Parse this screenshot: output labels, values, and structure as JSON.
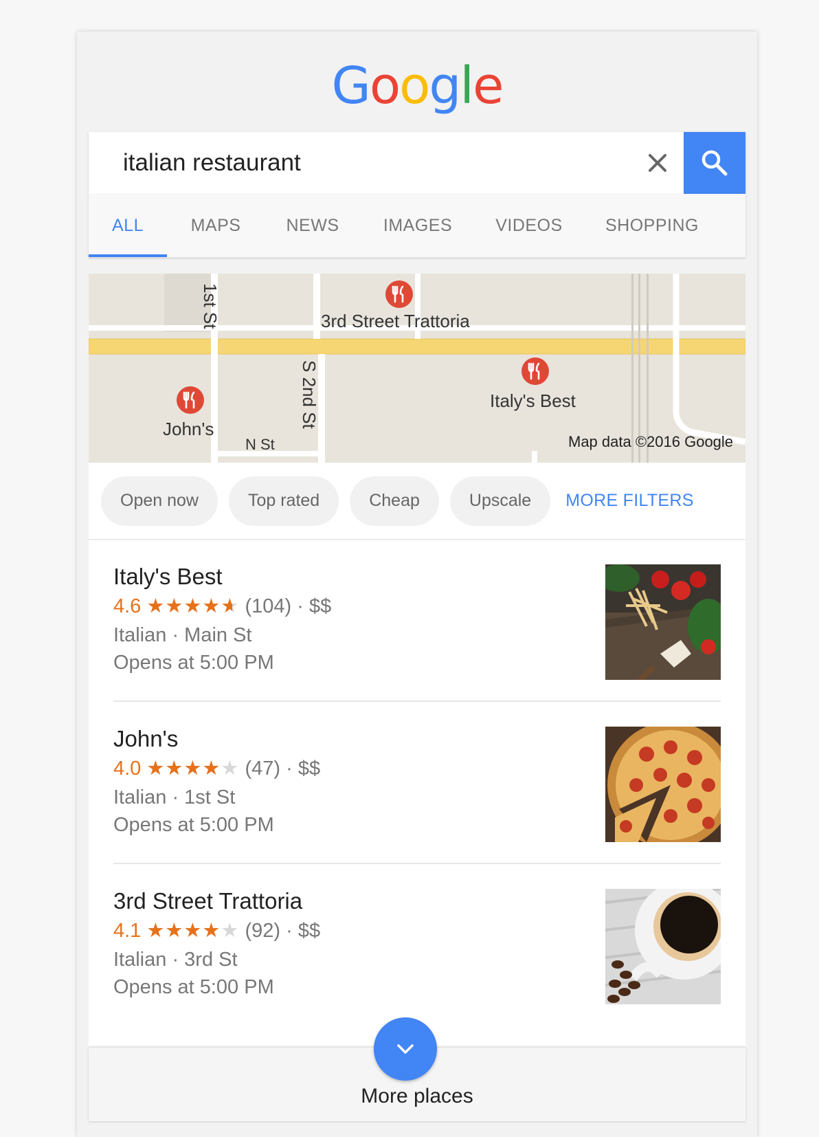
{
  "logo": {
    "letters": [
      "G",
      "o",
      "o",
      "g",
      "l",
      "e"
    ]
  },
  "colors": {
    "blue": "#4285f4",
    "red": "#ea4335",
    "yellow": "#fbbc05",
    "green": "#34a853",
    "star": "#e7711b"
  },
  "search": {
    "query": "italian restaurant"
  },
  "tabs": [
    {
      "label": "ALL",
      "active": true
    },
    {
      "label": "MAPS",
      "active": false
    },
    {
      "label": "NEWS",
      "active": false
    },
    {
      "label": "IMAGES",
      "active": false
    },
    {
      "label": "VIDEOS",
      "active": false
    },
    {
      "label": "SHOPPING",
      "active": false
    }
  ],
  "map": {
    "streets": {
      "first": "1st St",
      "second": "S 2nd St",
      "north": "N St"
    },
    "places": {
      "trattoria": "3rd Street Trattoria",
      "italys_best": "Italy's Best",
      "johns": "John's"
    },
    "credit": "Map data ©2016 Google",
    "pin_icon": "restaurant-pin-icon"
  },
  "filters": {
    "chips": [
      "Open now",
      "Top rated",
      "Cheap",
      "Upscale"
    ],
    "more": "MORE FILTERS"
  },
  "results": [
    {
      "name": "Italy's Best",
      "rating": "4.6",
      "rating_value": 4.6,
      "reviews": "(104)",
      "price": "$$",
      "category": "Italian",
      "street": "Main St",
      "hours": "Opens at 5:00 PM",
      "thumb_icon": "pasta-photo"
    },
    {
      "name": "John's",
      "rating": "4.0",
      "rating_value": 4.0,
      "reviews": "(47)",
      "price": "$$",
      "category": "Italian",
      "street": "1st St",
      "hours": "Opens at 5:00 PM",
      "thumb_icon": "pizza-photo"
    },
    {
      "name": "3rd Street Trattoria",
      "rating": "4.1",
      "rating_value": 4.1,
      "reviews": "(92)",
      "price": "$$",
      "category": "Italian",
      "street": "3rd St",
      "hours": "Opens at 5:00 PM",
      "thumb_icon": "coffee-photo"
    }
  ],
  "more_places": {
    "label": "More places",
    "icon": "chevron-down-icon"
  }
}
